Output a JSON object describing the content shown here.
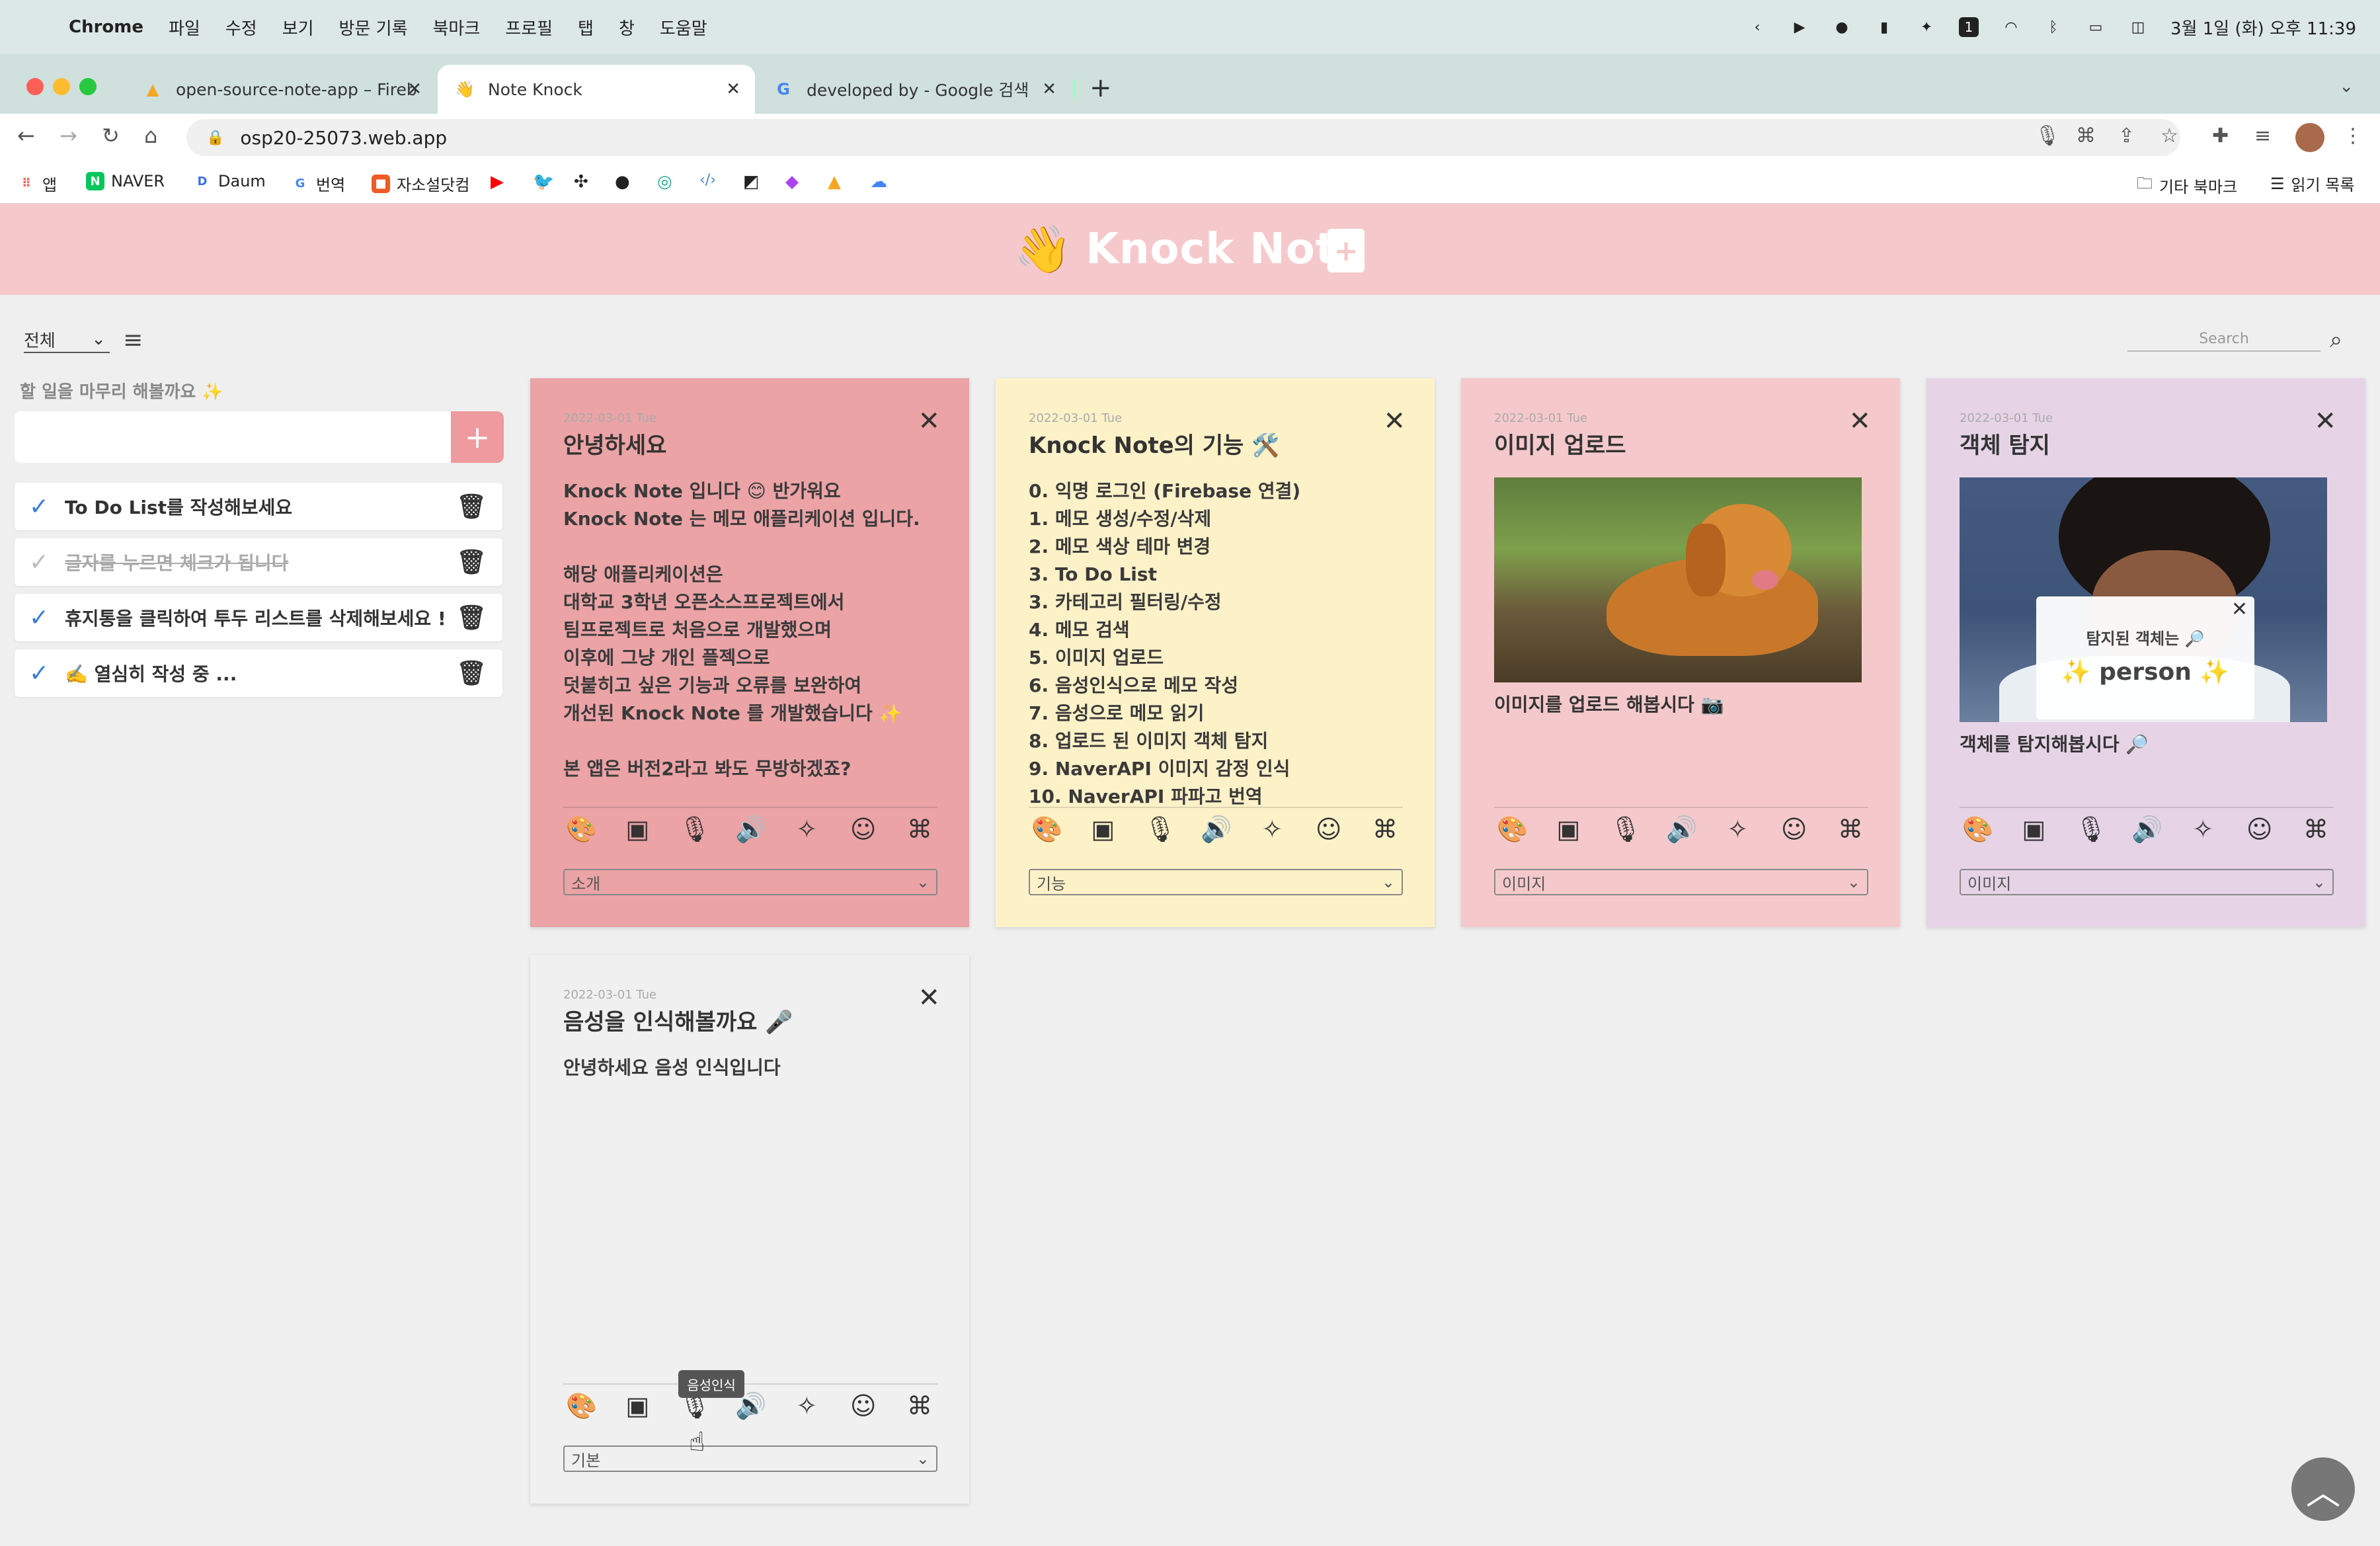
{
  "menubar": {
    "app": "Chrome",
    "items": [
      "파일",
      "수정",
      "보기",
      "방문 기록",
      "북마크",
      "프로필",
      "탭",
      "창",
      "도움말"
    ],
    "clock": "3월 1일 (화) 오후 11:39",
    "badge": "1"
  },
  "tabs": [
    {
      "title": "open-source-note-app – Fireb",
      "icon": "firebase-icon"
    },
    {
      "title": "Note Knock",
      "icon": "wave-icon"
    },
    {
      "title": "developed by - Google 검색",
      "icon": "google-icon"
    }
  ],
  "omnibox": {
    "url": "osp20-25073.web.app"
  },
  "bookmarks": {
    "items": [
      "앱",
      "NAVER",
      "Daum",
      "번역",
      "자소설닷컴"
    ],
    "other": "기타 북마크",
    "reading": "읽기 목록"
  },
  "header": {
    "title": "Knock Note",
    "emoji": "👋"
  },
  "controls": {
    "filter": "전체",
    "search_placeholder": "Search"
  },
  "todo": {
    "heading": "할 일을 마무리 해볼까요 ✨",
    "add": "+",
    "items": [
      {
        "text": "To Do List를 작성해보세요",
        "done": false
      },
      {
        "text": "글자를 누르면 체크가 됩니다",
        "done": true
      },
      {
        "text": "휴지통을 클릭하여 투두 리스트를 삭제해보세요 !",
        "done": false
      },
      {
        "text": "✍️ 열심히 작성 중 ...",
        "done": false
      }
    ]
  },
  "notes": [
    {
      "date": "2022-03-01 Tue",
      "title": "안녕하세요",
      "color": "#eba3a6",
      "category": "소개",
      "body": "Knock Note 입니다 😊 반가워요\nKnock Note 는 메모 애플리케이션 입니다.\n\n해당 애플리케이션은\n대학교 3학년 오픈소스프로젝트에서\n팀프로젝트로 처음으로 개발했으며\n이후에 그냥 개인 플젝으로\n덧붙히고 싶은 기능과 오류를 보완하여\n개선된 Knock Note 를 개발했습니다 ✨\n\n본 앱은 버전2라고 봐도 무방하겠죠?"
    },
    {
      "date": "2022-03-01 Tue",
      "title": "Knock Note의 기능 🛠️",
      "color": "#fdf1c8",
      "category": "기능",
      "body": "0. 익명 로그인 (Firebase 연결)\n1. 메모 생성/수정/삭제\n2. 메모 색상 테마 변경\n3. To Do List\n3. 카테고리 필터링/수정\n4. 메모 검색\n5. 이미지 업로드\n6. 음성인식으로 메모 작성\n7. 음성으로 메모 읽기\n8. 업로드 된 이미지 객체 탐지\n9. NaverAPI 이미지 감정 인식\n10. NaverAPI 파파고 번역"
    },
    {
      "date": "2022-03-01 Tue",
      "title": "이미지 업로드",
      "color": "#f5c9cb",
      "category": "이미지",
      "caption": "이미지를 업로드 해봅시다 📷"
    },
    {
      "date": "2022-03-01 Tue",
      "title": "객체 탐지",
      "color": "#e6d4e6",
      "category": "이미지",
      "caption": "객체를 탐지해봅시다 🔎",
      "detect_label": "탐지된 객체는 🔎",
      "detect_value": "✨ person ✨"
    },
    {
      "date": "2022-03-01 Tue",
      "title": "음성을 인식해볼까요 🎤",
      "color": "#f0f0f0",
      "category": "기본",
      "body": "안녕하세요 음성 인식입니다"
    }
  ],
  "tooltip": "음성인식"
}
